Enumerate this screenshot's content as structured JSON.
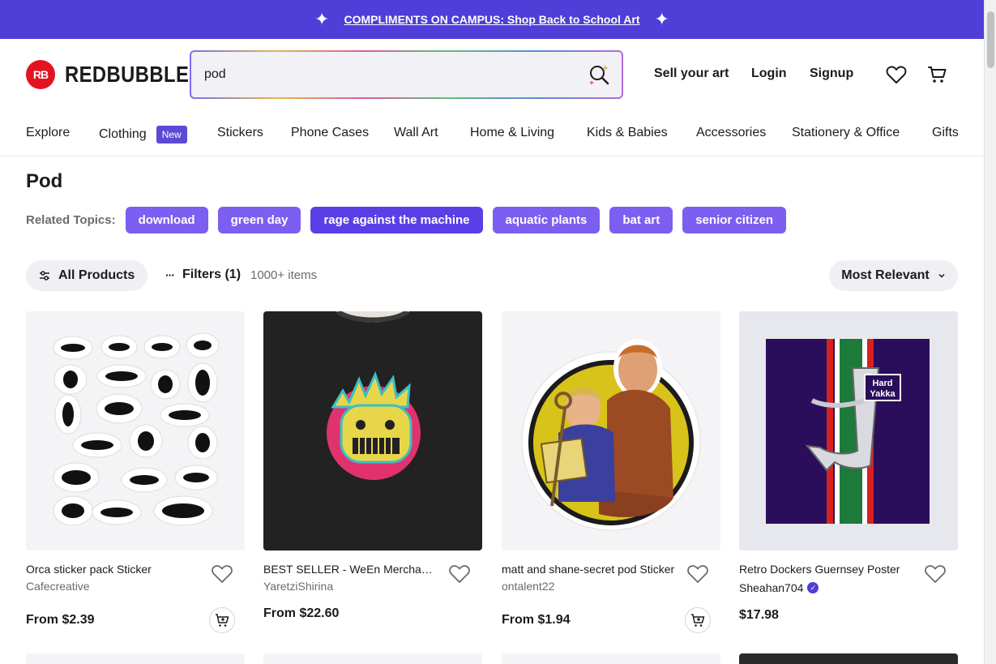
{
  "banner": {
    "text": "COMPLIMENTS ON CAMPUS: Shop Back to School Art"
  },
  "brand": {
    "logo_mark": "RB",
    "name": "REDBUBBLE",
    "accent": "#e41321",
    "primary": "#4f3ed8"
  },
  "search": {
    "value": "pod"
  },
  "header_links": {
    "sell": "Sell your art",
    "login": "Login",
    "signup": "Signup"
  },
  "categories": [
    {
      "label": "Explore"
    },
    {
      "label": "Clothing",
      "badge": "New"
    },
    {
      "label": "Stickers"
    },
    {
      "label": "Phone Cases"
    },
    {
      "label": "Wall Art"
    },
    {
      "label": "Home & Living"
    },
    {
      "label": "Kids & Babies"
    },
    {
      "label": "Accessories"
    },
    {
      "label": "Stationery & Office"
    },
    {
      "label": "Gifts"
    }
  ],
  "page": {
    "title": "Pod"
  },
  "related": {
    "label": "Related Topics:",
    "topics": [
      "download",
      "green day",
      "rage against the machine",
      "aquatic plants",
      "bat art",
      "senior citizen"
    ]
  },
  "controls": {
    "all_products": "All Products",
    "filters": "Filters (1)",
    "count": "1000+ items",
    "sort": "Most Relevant"
  },
  "products": [
    {
      "title": "Orca sticker pack Sticker",
      "artist": "Cafecreative",
      "price": "From $2.39",
      "add_to_cart": true
    },
    {
      "title": "BEST SELLER - WeEn Merchandise T-Shirt",
      "artist": "YaretziShirina",
      "price": "From $22.60",
      "add_to_cart": false
    },
    {
      "title": "matt and shane-secret pod Sticker",
      "artist": "ontalent22",
      "price": "From $1.94",
      "add_to_cart": true
    },
    {
      "title": "Retro Dockers Guernsey Poster",
      "artist": "Sheahan704",
      "verified": true,
      "price": "$17.98",
      "add_to_cart": false
    },
    {
      "poster_text_line1": "Hard",
      "poster_text_line2": "Yakka"
    }
  ]
}
